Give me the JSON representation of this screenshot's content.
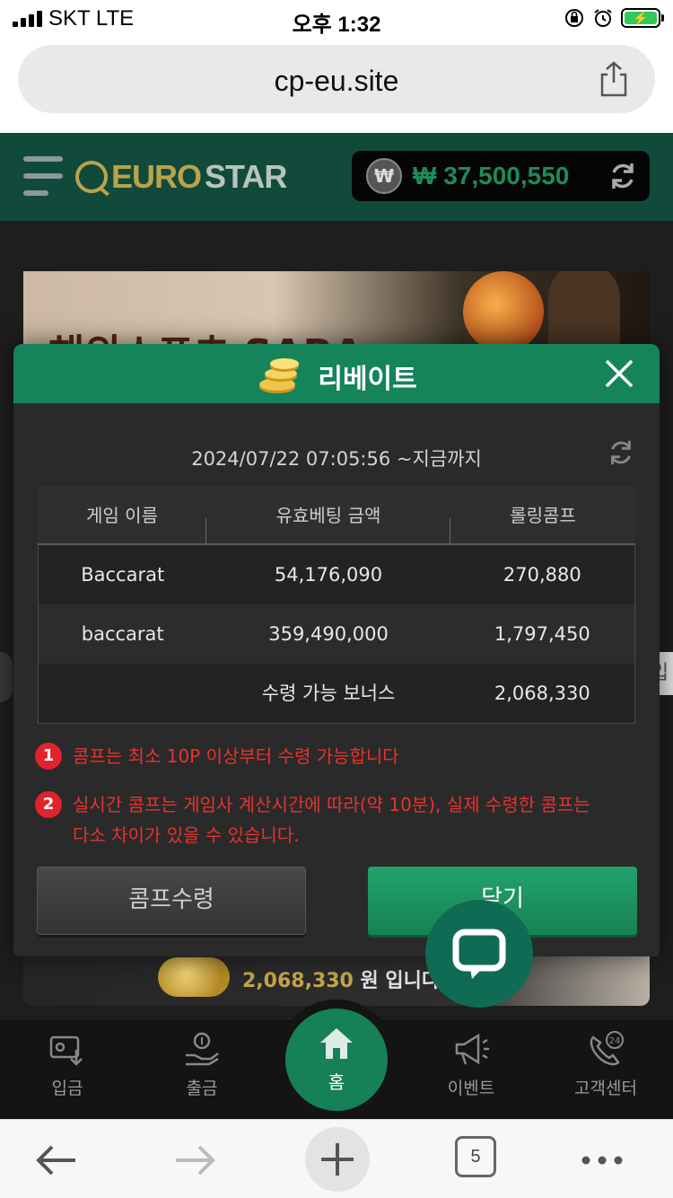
{
  "status_bar": {
    "carrier": "SKT   LTE",
    "time": "오후 1:32"
  },
  "browser": {
    "url": "cp-eu.site",
    "tabs_count": "5"
  },
  "site_header": {
    "logo_part1": "EURO",
    "logo_part2": "STAR",
    "balance": "₩ 37,500,550",
    "won_symbol": "₩"
  },
  "banner": {
    "text": "해외스포츠 SABA"
  },
  "side_tab_right": "입",
  "bottom_strip": {
    "amount": "2,068,330",
    "suffix": " 원 입니다."
  },
  "modal": {
    "title": "리베이트",
    "date_range": "2024/07/22 07:05:56 ~지금까지",
    "table": {
      "headers": [
        "게임 이름",
        "유효베팅 금액",
        "롤링콤프"
      ],
      "rows": [
        [
          "Baccarat",
          "54,176,090",
          "270,880"
        ],
        [
          "baccarat",
          "359,490,000",
          "1,797,450"
        ],
        [
          "",
          "수령 가능 보너스",
          "2,068,330"
        ]
      ]
    },
    "notes": [
      {
        "num": "1",
        "text": "콤프는 최소 10P 이상부터 수령 가능합니다"
      },
      {
        "num": "2",
        "text": "실시간 콤프는 게임사 계산시간에 따라(약 10분), 실제 수령한 콤프는\n다소 차이가 있을 수 있습니다."
      }
    ],
    "claim_button": "콤프수령",
    "close_button": "닫기"
  },
  "bottom_nav": {
    "deposit": "입금",
    "withdraw": "출금",
    "home": "홈",
    "event": "이벤트",
    "support": "고객센터"
  },
  "colors": {
    "header_bg": "#114a3a",
    "modal_header": "#15845b",
    "accent_gold": "#b9a34a",
    "warning_red": "#e8322f"
  }
}
